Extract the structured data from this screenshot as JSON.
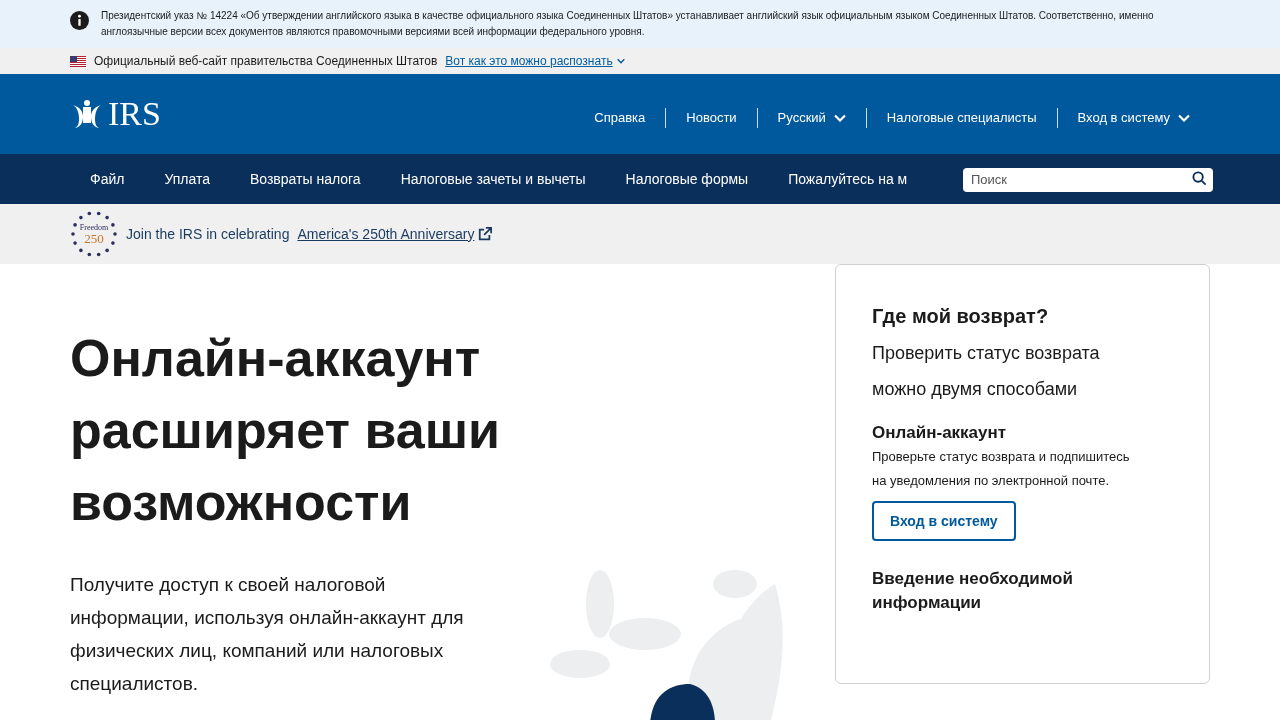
{
  "notice": {
    "text": "Президентский указ № 14224 «Об утверждении английского языка в качестве официального языка Соединенных Штатов» устанавливает английский язык официальным языком Соединенных Штатов. Соответственно, именно англоязычные версии всех документов являются правомочными версиями всей информации федерального уровня."
  },
  "gov_banner": {
    "text": "Официальный веб-сайт правительства Соединенных Штатов",
    "link": "Вот как это можно распознать",
    "expanded": false
  },
  "header": {
    "logo": "IRS",
    "links": [
      {
        "label": "Справка",
        "dropdown": false
      },
      {
        "label": "Новости",
        "dropdown": false
      },
      {
        "label": "Русский",
        "dropdown": true
      },
      {
        "label": "Налоговые специалисты",
        "dropdown": false
      },
      {
        "label": "Вход в систему",
        "dropdown": true
      }
    ]
  },
  "main_nav": {
    "items": [
      "Файл",
      "Уплата",
      "Возвраты налога",
      "Налоговые зачеты и вычеты",
      "Налоговые формы",
      "Пожалуйтесь на м"
    ],
    "search": {
      "placeholder": "Поиск"
    }
  },
  "promo": {
    "badge_top": "Freedom",
    "badge_number": "250",
    "text": "Join the IRS in celebrating",
    "link": "America's 250th Anniversary"
  },
  "hero": {
    "title": "Онлайн-аккаунт расширяет ваши возможности",
    "body": "Получите доступ к своей налоговой информации, используя онлайн-аккаунт для физических лиц, компаний или налоговых специалистов."
  },
  "refund_card": {
    "title": "Где мой возврат?",
    "subtitle": "Проверить статус возврата можно двумя способами",
    "sections": [
      {
        "kind": "button",
        "heading": "Онлайн-аккаунт",
        "text": "Проверьте статус возврата и подпишитесь на уведомления по электронной почте.",
        "button": "Вход в систему"
      },
      {
        "kind": "heading",
        "heading": "Введение необходимой информации"
      }
    ]
  }
}
